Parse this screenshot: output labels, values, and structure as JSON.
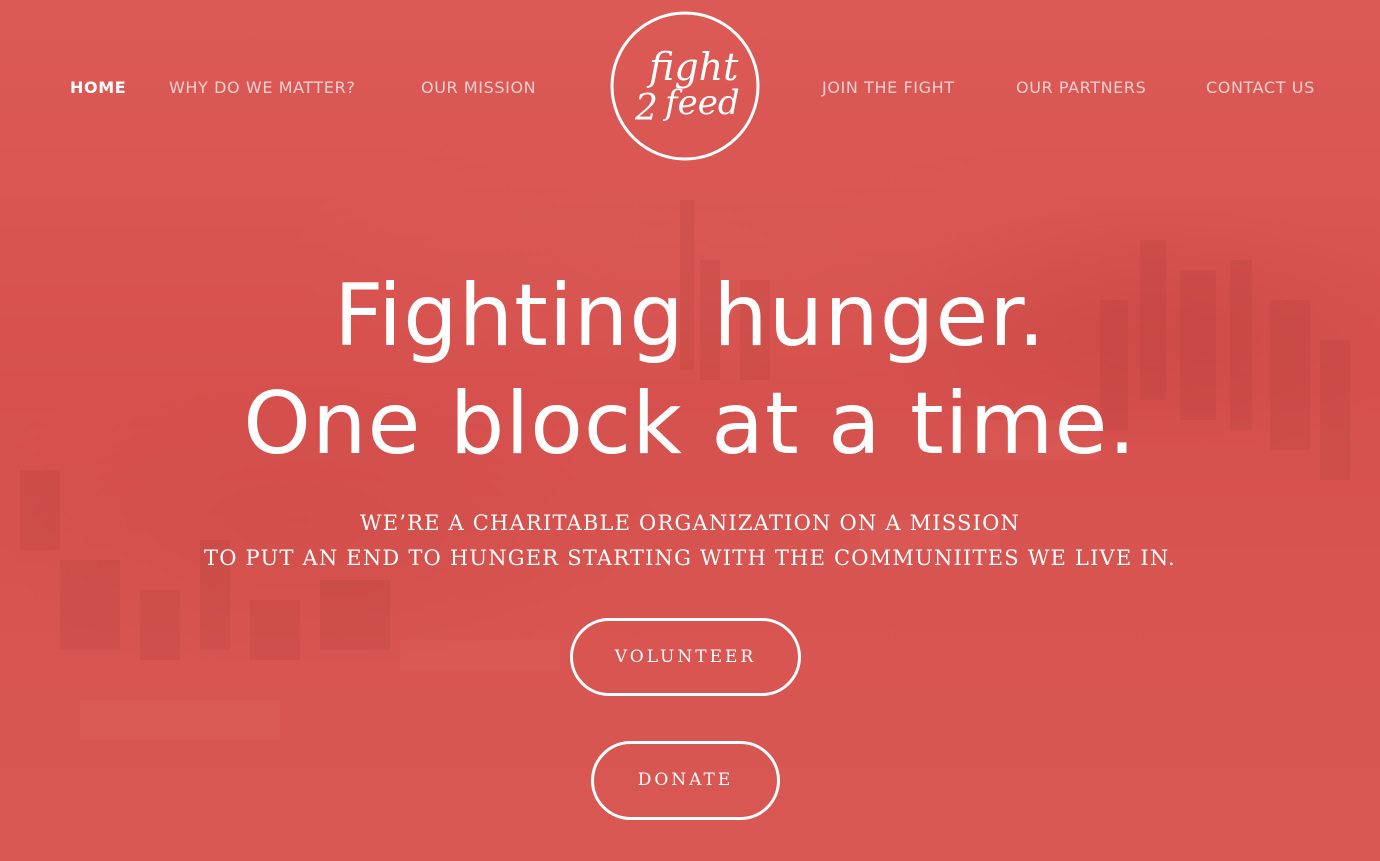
{
  "nav": {
    "left": [
      {
        "label": "HOME",
        "active": true
      },
      {
        "label": "WHY DO WE MATTER?",
        "active": false
      },
      {
        "label": "OUR MISSION",
        "active": false
      }
    ],
    "right": [
      {
        "label": "JOIN THE FIGHT",
        "active": false
      },
      {
        "label": "OUR PARTNERS",
        "active": false
      },
      {
        "label": "CONTACT US",
        "active": false
      }
    ]
  },
  "logo": {
    "line1": "fight",
    "line2": "2",
    "line3": "feed"
  },
  "hero": {
    "headline_line1": "Fighting hunger.",
    "headline_line2": "One block at a time.",
    "sub_line1": "WE’RE A CHARITABLE ORGANIZATION ON A MISSION",
    "sub_line2": "TO PUT AN END TO HUNGER STARTING WITH THE COMMUNIITES WE LIVE IN.",
    "volunteer_label": "VOLUNTEER",
    "donate_label": "DONATE"
  },
  "colors": {
    "background": "#d85450",
    "text": "#ffffff"
  }
}
